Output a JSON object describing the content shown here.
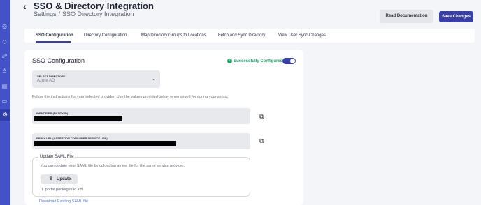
{
  "sidebar": {
    "icons": [
      "globe-icon",
      "layers-icon",
      "users-icon",
      "person-icon",
      "document-icon",
      "chat-icon",
      "settings-icon"
    ]
  },
  "header": {
    "back_glyph": "‹",
    "title": "SSO & Directory Integration",
    "breadcrumb": [
      "Settings",
      "/",
      "SSO Directory Integration"
    ],
    "read_docs_label": "Read Documentation",
    "save_label": "Save Changes"
  },
  "tabs": [
    {
      "label": "SSO Configuration",
      "active": true
    },
    {
      "label": "Directory Configuration",
      "active": false
    },
    {
      "label": "Map Directory Groups to Locations",
      "active": false
    },
    {
      "label": "Fetch and Sync Directory",
      "active": false
    },
    {
      "label": "View User Sync Changes",
      "active": false
    }
  ],
  "sso_card": {
    "title": "SSO Configuration",
    "status_text": "Successfully Configured",
    "toggle_on": true,
    "select": {
      "label": "SELECT DIRECTORY",
      "value": "Azure AD"
    },
    "instructions": "Follow the instructions for your selected provider. Use the values provided below when asked for during your setup.",
    "identifier_label": "IDENTIFIER (ENTITY ID)",
    "reply_url_label": "REPLY URL (ASSERTION CONSUMER SERVICE URL)",
    "saml": {
      "title": "Update SAML File",
      "description": "You can update your SAML file by uploading a new file for the same service provider.",
      "update_label": "Update",
      "file_name": "portal.packages.io.xml"
    },
    "download_link": "Download Existing SAML file"
  },
  "colors": {
    "sidebar": "#4353c7",
    "accent": "#3a3fa3",
    "success": "#22a06b",
    "link": "#5b7fd6"
  }
}
